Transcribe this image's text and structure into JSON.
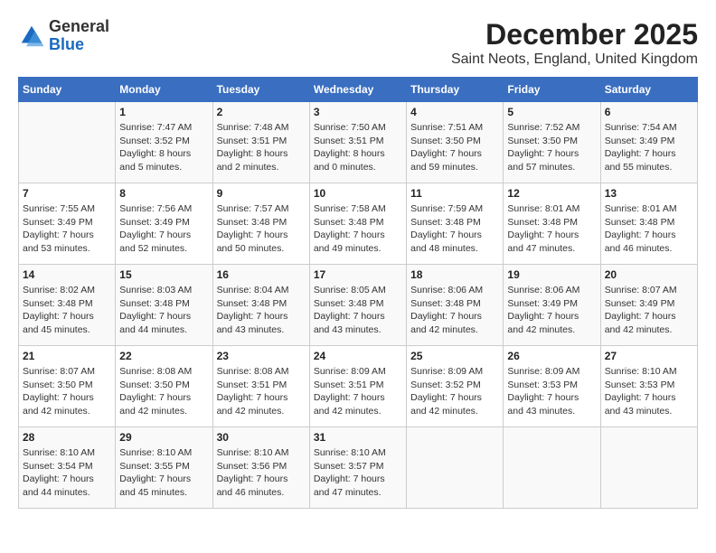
{
  "header": {
    "logo_line1": "General",
    "logo_line2": "Blue",
    "title": "December 2025",
    "subtitle": "Saint Neots, England, United Kingdom"
  },
  "calendar": {
    "days_of_week": [
      "Sunday",
      "Monday",
      "Tuesday",
      "Wednesday",
      "Thursday",
      "Friday",
      "Saturday"
    ],
    "weeks": [
      [
        {
          "day": "",
          "sunrise": "",
          "sunset": "",
          "daylight": ""
        },
        {
          "day": "1",
          "sunrise": "Sunrise: 7:47 AM",
          "sunset": "Sunset: 3:52 PM",
          "daylight": "Daylight: 8 hours and 5 minutes."
        },
        {
          "day": "2",
          "sunrise": "Sunrise: 7:48 AM",
          "sunset": "Sunset: 3:51 PM",
          "daylight": "Daylight: 8 hours and 2 minutes."
        },
        {
          "day": "3",
          "sunrise": "Sunrise: 7:50 AM",
          "sunset": "Sunset: 3:51 PM",
          "daylight": "Daylight: 8 hours and 0 minutes."
        },
        {
          "day": "4",
          "sunrise": "Sunrise: 7:51 AM",
          "sunset": "Sunset: 3:50 PM",
          "daylight": "Daylight: 7 hours and 59 minutes."
        },
        {
          "day": "5",
          "sunrise": "Sunrise: 7:52 AM",
          "sunset": "Sunset: 3:50 PM",
          "daylight": "Daylight: 7 hours and 57 minutes."
        },
        {
          "day": "6",
          "sunrise": "Sunrise: 7:54 AM",
          "sunset": "Sunset: 3:49 PM",
          "daylight": "Daylight: 7 hours and 55 minutes."
        }
      ],
      [
        {
          "day": "7",
          "sunrise": "Sunrise: 7:55 AM",
          "sunset": "Sunset: 3:49 PM",
          "daylight": "Daylight: 7 hours and 53 minutes."
        },
        {
          "day": "8",
          "sunrise": "Sunrise: 7:56 AM",
          "sunset": "Sunset: 3:49 PM",
          "daylight": "Daylight: 7 hours and 52 minutes."
        },
        {
          "day": "9",
          "sunrise": "Sunrise: 7:57 AM",
          "sunset": "Sunset: 3:48 PM",
          "daylight": "Daylight: 7 hours and 50 minutes."
        },
        {
          "day": "10",
          "sunrise": "Sunrise: 7:58 AM",
          "sunset": "Sunset: 3:48 PM",
          "daylight": "Daylight: 7 hours and 49 minutes."
        },
        {
          "day": "11",
          "sunrise": "Sunrise: 7:59 AM",
          "sunset": "Sunset: 3:48 PM",
          "daylight": "Daylight: 7 hours and 48 minutes."
        },
        {
          "day": "12",
          "sunrise": "Sunrise: 8:01 AM",
          "sunset": "Sunset: 3:48 PM",
          "daylight": "Daylight: 7 hours and 47 minutes."
        },
        {
          "day": "13",
          "sunrise": "Sunrise: 8:01 AM",
          "sunset": "Sunset: 3:48 PM",
          "daylight": "Daylight: 7 hours and 46 minutes."
        }
      ],
      [
        {
          "day": "14",
          "sunrise": "Sunrise: 8:02 AM",
          "sunset": "Sunset: 3:48 PM",
          "daylight": "Daylight: 7 hours and 45 minutes."
        },
        {
          "day": "15",
          "sunrise": "Sunrise: 8:03 AM",
          "sunset": "Sunset: 3:48 PM",
          "daylight": "Daylight: 7 hours and 44 minutes."
        },
        {
          "day": "16",
          "sunrise": "Sunrise: 8:04 AM",
          "sunset": "Sunset: 3:48 PM",
          "daylight": "Daylight: 7 hours and 43 minutes."
        },
        {
          "day": "17",
          "sunrise": "Sunrise: 8:05 AM",
          "sunset": "Sunset: 3:48 PM",
          "daylight": "Daylight: 7 hours and 43 minutes."
        },
        {
          "day": "18",
          "sunrise": "Sunrise: 8:06 AM",
          "sunset": "Sunset: 3:48 PM",
          "daylight": "Daylight: 7 hours and 42 minutes."
        },
        {
          "day": "19",
          "sunrise": "Sunrise: 8:06 AM",
          "sunset": "Sunset: 3:49 PM",
          "daylight": "Daylight: 7 hours and 42 minutes."
        },
        {
          "day": "20",
          "sunrise": "Sunrise: 8:07 AM",
          "sunset": "Sunset: 3:49 PM",
          "daylight": "Daylight: 7 hours and 42 minutes."
        }
      ],
      [
        {
          "day": "21",
          "sunrise": "Sunrise: 8:07 AM",
          "sunset": "Sunset: 3:50 PM",
          "daylight": "Daylight: 7 hours and 42 minutes."
        },
        {
          "day": "22",
          "sunrise": "Sunrise: 8:08 AM",
          "sunset": "Sunset: 3:50 PM",
          "daylight": "Daylight: 7 hours and 42 minutes."
        },
        {
          "day": "23",
          "sunrise": "Sunrise: 8:08 AM",
          "sunset": "Sunset: 3:51 PM",
          "daylight": "Daylight: 7 hours and 42 minutes."
        },
        {
          "day": "24",
          "sunrise": "Sunrise: 8:09 AM",
          "sunset": "Sunset: 3:51 PM",
          "daylight": "Daylight: 7 hours and 42 minutes."
        },
        {
          "day": "25",
          "sunrise": "Sunrise: 8:09 AM",
          "sunset": "Sunset: 3:52 PM",
          "daylight": "Daylight: 7 hours and 42 minutes."
        },
        {
          "day": "26",
          "sunrise": "Sunrise: 8:09 AM",
          "sunset": "Sunset: 3:53 PM",
          "daylight": "Daylight: 7 hours and 43 minutes."
        },
        {
          "day": "27",
          "sunrise": "Sunrise: 8:10 AM",
          "sunset": "Sunset: 3:53 PM",
          "daylight": "Daylight: 7 hours and 43 minutes."
        }
      ],
      [
        {
          "day": "28",
          "sunrise": "Sunrise: 8:10 AM",
          "sunset": "Sunset: 3:54 PM",
          "daylight": "Daylight: 7 hours and 44 minutes."
        },
        {
          "day": "29",
          "sunrise": "Sunrise: 8:10 AM",
          "sunset": "Sunset: 3:55 PM",
          "daylight": "Daylight: 7 hours and 45 minutes."
        },
        {
          "day": "30",
          "sunrise": "Sunrise: 8:10 AM",
          "sunset": "Sunset: 3:56 PM",
          "daylight": "Daylight: 7 hours and 46 minutes."
        },
        {
          "day": "31",
          "sunrise": "Sunrise: 8:10 AM",
          "sunset": "Sunset: 3:57 PM",
          "daylight": "Daylight: 7 hours and 47 minutes."
        },
        {
          "day": "",
          "sunrise": "",
          "sunset": "",
          "daylight": ""
        },
        {
          "day": "",
          "sunrise": "",
          "sunset": "",
          "daylight": ""
        },
        {
          "day": "",
          "sunrise": "",
          "sunset": "",
          "daylight": ""
        }
      ]
    ]
  }
}
